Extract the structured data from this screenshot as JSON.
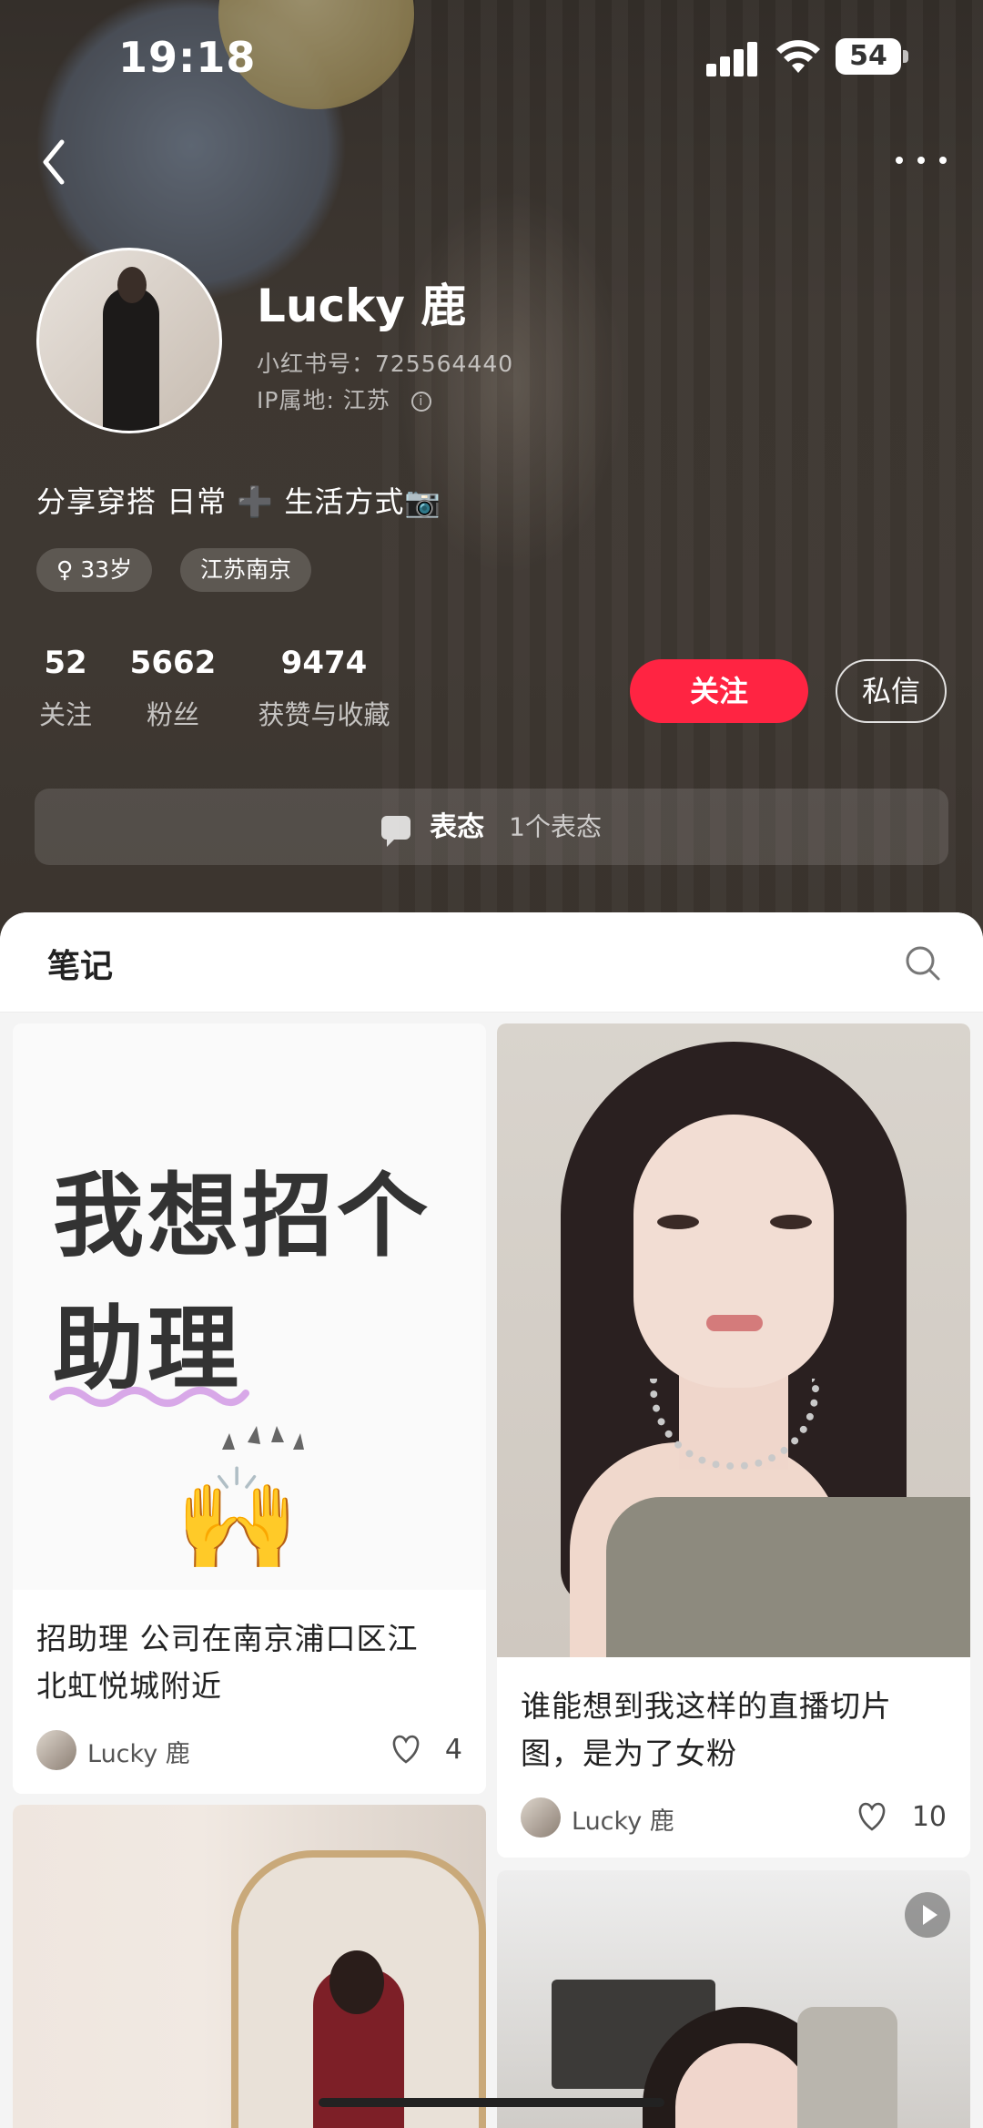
{
  "status_bar": {
    "time": "19:18",
    "battery": "54"
  },
  "profile": {
    "name": "Lucky 鹿",
    "red_id": "小红书号：725564440",
    "ip_location": "IP属地: 江苏",
    "bio": "分享穿搭  日常 ➕ 生活方式📷",
    "tags": {
      "gender_age": "♀ 33岁",
      "location": "江苏南京"
    },
    "stats": [
      {
        "value": "52",
        "label": "关注"
      },
      {
        "value": "5662",
        "label": "粉丝"
      },
      {
        "value": "9474",
        "label": "获赞与收藏"
      }
    ],
    "follow_label": "关注",
    "message_label": "私信",
    "mood": {
      "label": "表态",
      "count": "1个表态"
    }
  },
  "tabs": {
    "notes": "笔记"
  },
  "notes": [
    {
      "cover_text": {
        "line1": "我想招个",
        "line2": "助理",
        "emoji": "🙌"
      },
      "title_line1": "招助理 公司在南京浦口区江",
      "title_line2": "北虹悦城附近",
      "author": "Lucky 鹿",
      "likes": "4"
    },
    {
      "title_line1": "谁能想到我这样的直播切片",
      "title_line2": "图，是为了女粉",
      "author": "Lucky 鹿",
      "likes": "10"
    }
  ],
  "icons": {
    "back": "chevron-left-icon",
    "more": "more-dots-icon",
    "search": "search-icon",
    "like": "heart-icon",
    "play": "play-icon",
    "mood": "comment-bubble-icon",
    "info": "info-icon"
  },
  "colors": {
    "accent": "#ff2442"
  }
}
